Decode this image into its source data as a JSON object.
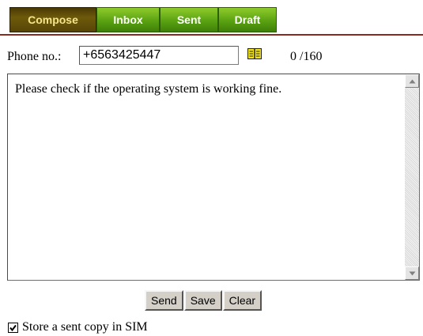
{
  "tabs": [
    {
      "label": "Compose",
      "active": true
    },
    {
      "label": "Inbox",
      "active": false
    },
    {
      "label": "Sent",
      "active": false
    },
    {
      "label": "Draft",
      "active": false
    }
  ],
  "phone": {
    "label": "Phone no.:",
    "value": "+6563425447",
    "phonebook_icon": "phonebook-icon"
  },
  "counter": {
    "text": "0 /160"
  },
  "message": {
    "text": "Please check if the operating system is working fine."
  },
  "buttons": {
    "send": "Send",
    "save": "Save",
    "clear": "Clear"
  },
  "store_copy": {
    "label": "Store a sent copy in SIM",
    "checked": true
  },
  "colors": {
    "tab_active_bg": "#5a4808",
    "tab_active_text": "#f6e58a",
    "tab_bg": "#5aa212",
    "tab_rule": "#8a2b22"
  }
}
